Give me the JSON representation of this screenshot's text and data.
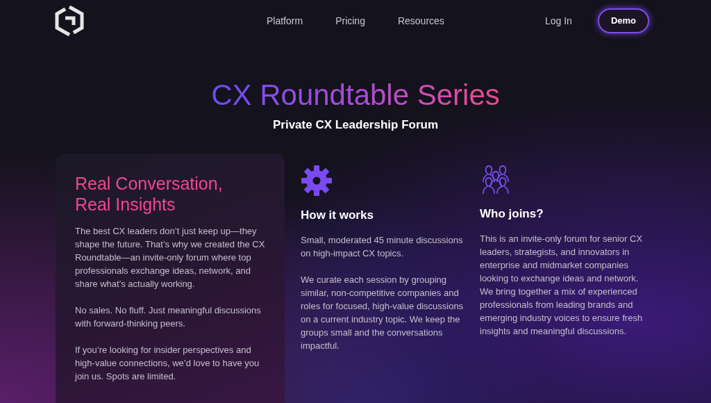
{
  "nav": {
    "links": [
      {
        "label": "Platform"
      },
      {
        "label": "Pricing"
      },
      {
        "label": "Resources"
      }
    ],
    "login": "Log In",
    "demo": "Demo"
  },
  "hero": {
    "title": "CX Roundtable Series",
    "subtitle": "Private CX Leadership Forum"
  },
  "intro_card": {
    "heading": [
      "Real Conversation,",
      "Real Insights"
    ],
    "paragraphs": [
      "The best CX leaders don’t just keep up—they shape the future. That’s why we created the CX Roundtable—an invite-only forum where top professionals exchange ideas, network, and share what’s actually working.",
      "No sales. No fluff. Just meaningful discussions with forward-thinking peers.",
      "If you’re looking for insider perspectives and high-value connections, we’d love to have you join us. Spots are limited."
    ]
  },
  "features": [
    {
      "kind": "gear",
      "title": "How it works",
      "paragraphs": [
        "Small, moderated 45 minute discussions on high-impact CX topics.",
        "We curate each session by grouping similar, non-competitive companies and roles for focused, high-value discussions on a current industry topic. We keep the groups small and the conversations impactful."
      ]
    },
    {
      "kind": "people",
      "title": "Who joins?",
      "paragraphs": [
        "This is an invite-only forum for senior CX leaders, strategists, and innovators in enterprise and midmarket companies looking to exchange ideas and network. We bring together a mix of experienced professionals from leading brands and emerging industry voices to ensure fresh insights and meaningful discussions."
      ]
    }
  ]
}
